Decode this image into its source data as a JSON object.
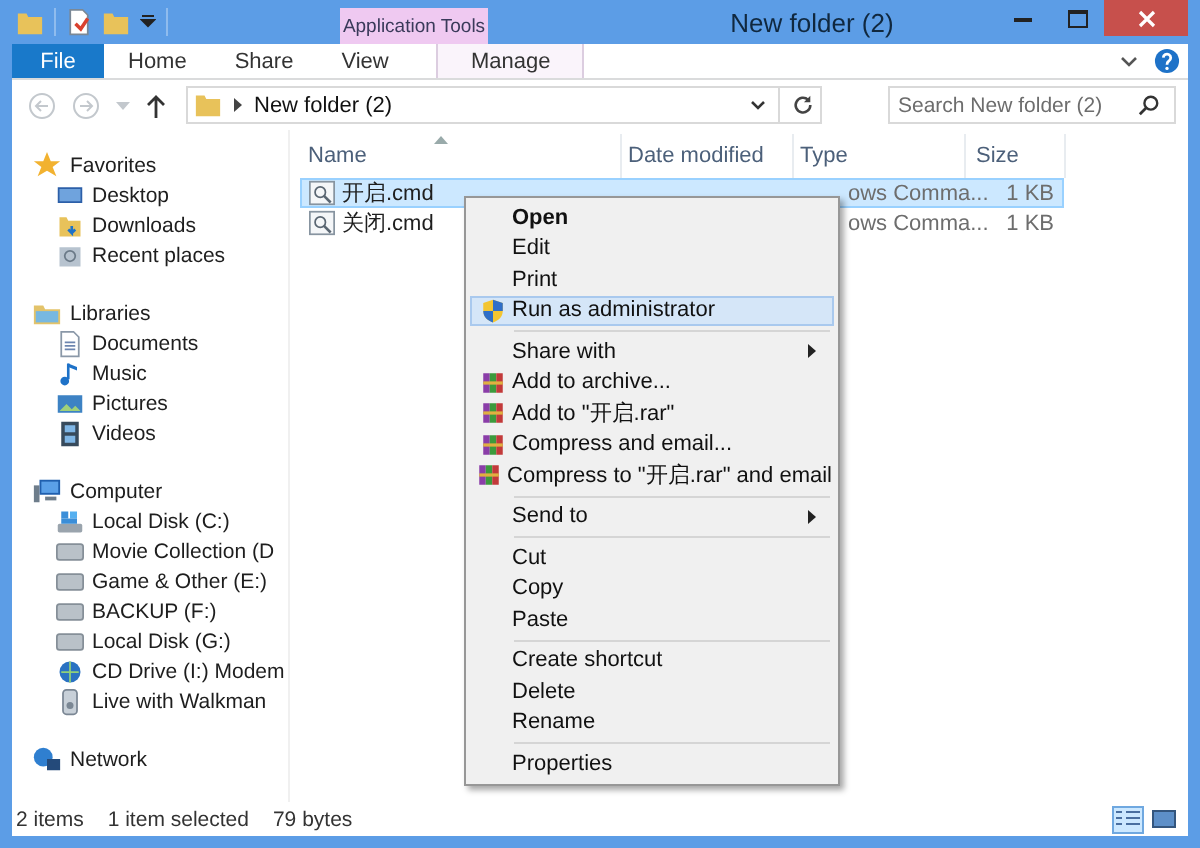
{
  "window": {
    "title": "New folder (2)"
  },
  "ribbon": {
    "context_group": "Application Tools",
    "tabs": [
      {
        "label": "File",
        "kind": "file",
        "selected": false
      },
      {
        "label": "Home",
        "kind": "plain",
        "selected": false
      },
      {
        "label": "Share",
        "kind": "plain",
        "selected": false
      },
      {
        "label": "View",
        "kind": "plain",
        "selected": false
      },
      {
        "label": "Manage",
        "kind": "context",
        "selected": false
      }
    ]
  },
  "address": {
    "path": "New folder (2)"
  },
  "search": {
    "placeholder": "Search New folder (2)"
  },
  "nav": [
    {
      "label": "Favorites",
      "kind": "star",
      "children": [
        {
          "label": "Desktop",
          "kind": "desktop"
        },
        {
          "label": "Downloads",
          "kind": "download"
        },
        {
          "label": "Recent places",
          "kind": "recent"
        }
      ]
    },
    {
      "label": "Libraries",
      "kind": "library",
      "children": [
        {
          "label": "Documents",
          "kind": "document"
        },
        {
          "label": "Music",
          "kind": "music"
        },
        {
          "label": "Pictures",
          "kind": "picture"
        },
        {
          "label": "Videos",
          "kind": "video"
        }
      ]
    },
    {
      "label": "Computer",
      "kind": "computer",
      "children": [
        {
          "label": "Local Disk (C:)",
          "kind": "sysdisk"
        },
        {
          "label": "Movie Collection (D",
          "kind": "disk"
        },
        {
          "label": "Game & Other (E:)",
          "kind": "disk"
        },
        {
          "label": "BACKUP (F:)",
          "kind": "disk"
        },
        {
          "label": "Local Disk (G:)",
          "kind": "disk"
        },
        {
          "label": "CD Drive (I:) Modem",
          "kind": "cd"
        },
        {
          "label": "Live with Walkman",
          "kind": "device"
        }
      ]
    },
    {
      "label": "Network",
      "kind": "network"
    }
  ],
  "table": {
    "columns": [
      "Name",
      "Date modified",
      "Type",
      "Size"
    ],
    "rows": [
      {
        "name": "开启.cmd",
        "type": "ows Comma...",
        "size": "1 KB",
        "selected": true
      },
      {
        "name": "关闭.cmd",
        "type": "ows Comma...",
        "size": "1 KB",
        "selected": false
      }
    ]
  },
  "context_menu": {
    "groups": [
      [
        {
          "label": "Open",
          "kind": "plain",
          "default": true,
          "submenu": false,
          "selected": false
        },
        {
          "label": "Edit",
          "kind": "plain",
          "default": false,
          "submenu": false,
          "selected": false
        },
        {
          "label": "Print",
          "kind": "plain",
          "default": false,
          "submenu": false,
          "selected": false
        },
        {
          "label": "Run as administrator",
          "kind": "shield",
          "default": false,
          "submenu": false,
          "selected": true
        }
      ],
      [
        {
          "label": "Share with",
          "kind": "plain",
          "default": false,
          "submenu": true,
          "selected": false
        },
        {
          "label": "Add to archive...",
          "kind": "archive",
          "default": false,
          "submenu": false,
          "selected": false
        },
        {
          "label": "Add to \"开启.rar\"",
          "kind": "archive",
          "default": false,
          "submenu": false,
          "selected": false
        },
        {
          "label": "Compress and email...",
          "kind": "archive",
          "default": false,
          "submenu": false,
          "selected": false
        },
        {
          "label": "Compress to \"开启.rar\" and email",
          "kind": "archive",
          "default": false,
          "submenu": false,
          "selected": false
        }
      ],
      [
        {
          "label": "Send to",
          "kind": "plain",
          "default": false,
          "submenu": true,
          "selected": false
        }
      ],
      [
        {
          "label": "Cut",
          "kind": "plain",
          "default": false,
          "submenu": false,
          "selected": false
        },
        {
          "label": "Copy",
          "kind": "plain",
          "default": false,
          "submenu": false,
          "selected": false
        },
        {
          "label": "Paste",
          "kind": "plain",
          "default": false,
          "submenu": false,
          "selected": false
        }
      ],
      [
        {
          "label": "Create shortcut",
          "kind": "plain",
          "default": false,
          "submenu": false,
          "selected": false
        },
        {
          "label": "Delete",
          "kind": "plain",
          "default": false,
          "submenu": false,
          "selected": false
        },
        {
          "label": "Rename",
          "kind": "plain",
          "default": false,
          "submenu": false,
          "selected": false
        }
      ],
      [
        {
          "label": "Properties",
          "kind": "plain",
          "default": false,
          "submenu": false,
          "selected": false
        }
      ]
    ]
  },
  "status_bar": {
    "item_count": "2 items",
    "selection": "1 item selected",
    "size": "79 bytes",
    "views": [
      {
        "kind": "details",
        "selected": true
      },
      {
        "kind": "large",
        "selected": false
      }
    ]
  }
}
